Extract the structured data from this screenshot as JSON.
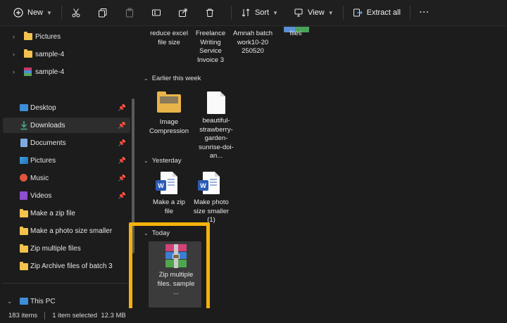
{
  "toolbar": {
    "new_label": "New",
    "sort_label": "Sort",
    "view_label": "View",
    "extract_label": "Extract all",
    "more_label": "···"
  },
  "sidebar": {
    "items": [
      {
        "label": "Pictures",
        "icon": "folder-icon",
        "expandable": true
      },
      {
        "label": "sample-4",
        "icon": "folder-icon",
        "expandable": true
      },
      {
        "label": "sample-4",
        "icon": "archive-icon",
        "expandable": true
      },
      {
        "label": "Desktop",
        "icon": "desktop-icon",
        "pinned": true
      },
      {
        "label": "Downloads",
        "icon": "download-icon",
        "pinned": true,
        "selected": true
      },
      {
        "label": "Documents",
        "icon": "documents-icon",
        "pinned": true
      },
      {
        "label": "Pictures",
        "icon": "pictures-icon",
        "pinned": true
      },
      {
        "label": "Music",
        "icon": "music-icon",
        "pinned": true
      },
      {
        "label": "Videos",
        "icon": "videos-icon",
        "pinned": true
      },
      {
        "label": "Make a zip file",
        "icon": "folder-icon"
      },
      {
        "label": "Make a photo size smaller",
        "icon": "folder-icon"
      },
      {
        "label": "Zip multiple files",
        "icon": "folder-icon"
      },
      {
        "label": "Zip Archive files of batch 3",
        "icon": "folder-icon"
      },
      {
        "label": "This PC",
        "icon": "pc-icon",
        "expanded": true
      }
    ]
  },
  "content": {
    "top_files": [
      {
        "label": "reduce excel file size"
      },
      {
        "label": "Freelance Writing Service Invoice 3"
      },
      {
        "label": "Amnah batch work10-20 250520"
      },
      {
        "label": "files"
      }
    ],
    "groups": [
      {
        "header": "Earlier this week",
        "files": [
          {
            "label": "Image Compression",
            "icon": "folder-icon"
          },
          {
            "label": "beautiful-strawberry-garden-sunrise-doi-an...",
            "icon": "document-icon"
          }
        ]
      },
      {
        "header": "Yesterday",
        "files": [
          {
            "label": "Make a zip file",
            "icon": "word-doc-icon"
          },
          {
            "label": "Make photo size smaller (1)",
            "icon": "word-doc-icon"
          }
        ]
      },
      {
        "header": "Today",
        "files": [
          {
            "label": "Zip multiple files. sample ...",
            "icon": "winrar-archive-icon",
            "selected": true
          }
        ]
      }
    ]
  },
  "status": {
    "item_count": "183 items",
    "selection": "1 item selected  12.3 MB"
  },
  "colors": {
    "highlight": "#f5b20c",
    "folder": "#f2c14e",
    "word_blue": "#2b5bb6"
  }
}
